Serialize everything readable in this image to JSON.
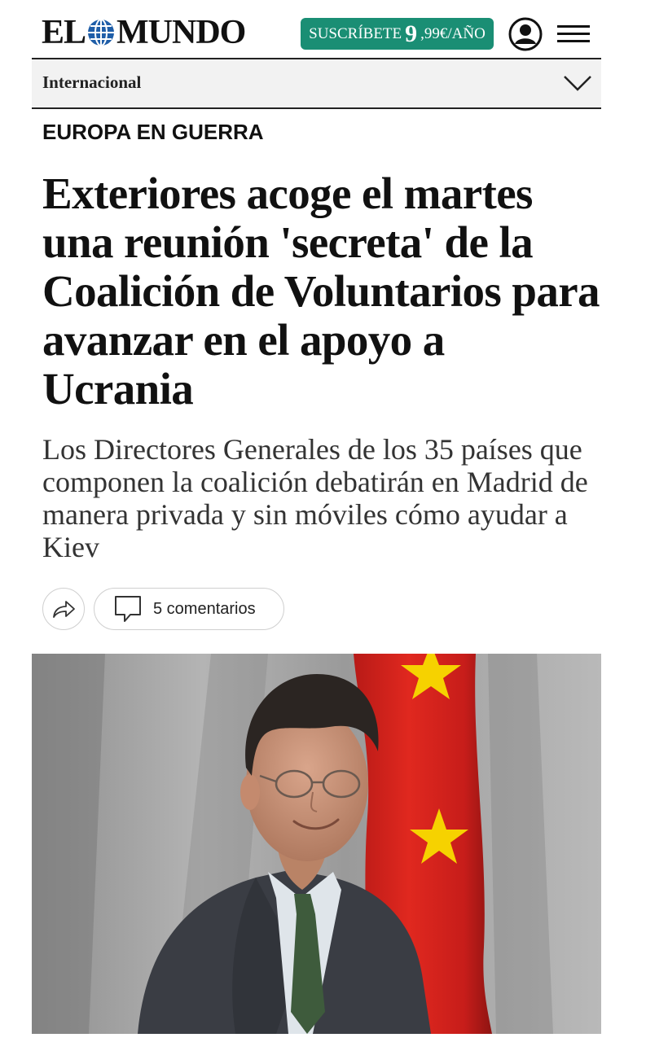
{
  "header": {
    "logo_left": "EL",
    "logo_right": "MUNDO",
    "subscribe": {
      "prefix": "SUSCRÍBETE",
      "big": "9",
      "suffix": ",99€/AÑO"
    },
    "icons": [
      "globe-icon",
      "user-account-icon",
      "hamburger-menu-icon"
    ],
    "colors": {
      "subscribe_bg": "#1a8e74",
      "globe_blue": "#1f5ea8"
    }
  },
  "section": {
    "label": "Internacional",
    "icon": "chevron-down-icon"
  },
  "article": {
    "kicker": "EUROPA EN GUERRA",
    "headline": "Exteriores acoge el martes una reunión 'secreta' de la Coalición de Voluntarios para avanzar en el apoyo a Ucrania",
    "subtitle": "Los Directores Generales de los 35 países que componen la coalición debatirán en Madrid de manera privada y sin móviles cómo ayudar a Kiev",
    "comments_label": "5 comentarios",
    "action_icons": [
      "share-icon",
      "comment-icon"
    ]
  },
  "photo": {
    "flag_colors": {
      "red": "#d8231f",
      "star": "#f6d200"
    }
  }
}
